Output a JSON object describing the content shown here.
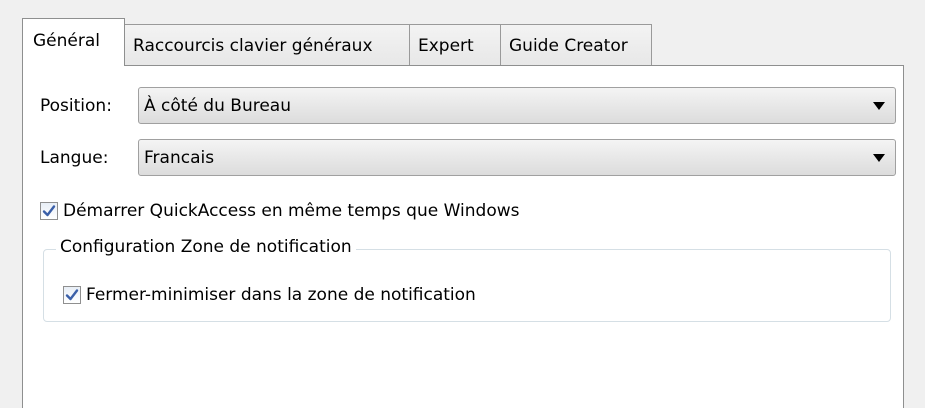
{
  "tabs": [
    {
      "label": "Général",
      "active": true
    },
    {
      "label": "Raccourcis clavier généraux",
      "active": false
    },
    {
      "label": "Expert",
      "active": false
    },
    {
      "label": "Guide Creator",
      "active": false
    }
  ],
  "general": {
    "position": {
      "label": "Position:",
      "value": "À côté du Bureau"
    },
    "langue": {
      "label": "Langue:",
      "value": "Francais"
    },
    "startup_checkbox": {
      "label": "Démarrer QuickAccess en même temps que Windows",
      "checked": true
    },
    "notification_group": {
      "title": "Configuration Zone de notification",
      "minimize_checkbox": {
        "label": "Fermer-minimiser dans la zone de notification",
        "checked": true
      }
    }
  },
  "colors": {
    "check_mark": "#3a5fa8",
    "border": "#8e8f8f",
    "panel_bg": "#ffffff",
    "window_bg": "#f0f0f0"
  },
  "icons": {
    "dropdown": "chevron-down-icon",
    "check": "checkmark-icon"
  }
}
